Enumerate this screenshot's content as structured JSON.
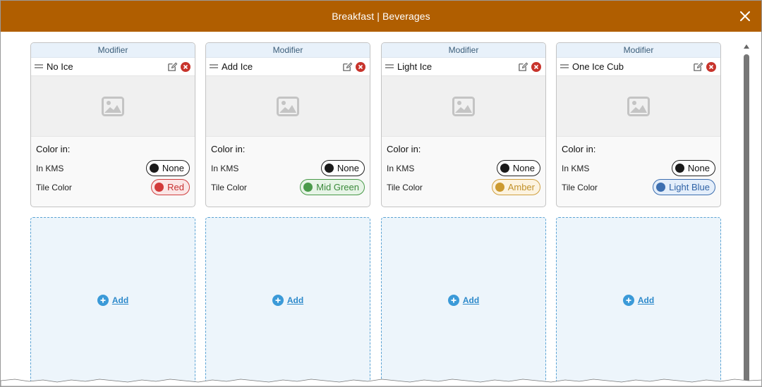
{
  "window": {
    "title": "Breakfast | Beverages"
  },
  "tiles": [
    {
      "header": "Modifier",
      "name": "No Ice",
      "color_in_label": "Color in:",
      "kms_label": "In KMS",
      "kms_value": "None",
      "tile_color_label": "Tile Color",
      "tile_color_value": "Red"
    },
    {
      "header": "Modifier",
      "name": "Add Ice",
      "color_in_label": "Color in:",
      "kms_label": "In KMS",
      "kms_value": "None",
      "tile_color_label": "Tile Color",
      "tile_color_value": "Mid Green"
    },
    {
      "header": "Modifier",
      "name": "Light Ice",
      "color_in_label": "Color in:",
      "kms_label": "In KMS",
      "kms_value": "None",
      "tile_color_label": "Tile Color",
      "tile_color_value": "Amber"
    },
    {
      "header": "Modifier",
      "name": "One Ice Cub",
      "color_in_label": "Color in:",
      "kms_label": "In KMS",
      "kms_value": "None",
      "tile_color_label": "Tile Color",
      "tile_color_value": "Light Blue"
    }
  ],
  "add_slots": [
    {
      "label": "Add"
    },
    {
      "label": "Add"
    },
    {
      "label": "Add"
    },
    {
      "label": "Add"
    }
  ],
  "colors": {
    "titlebar": "#b05e00",
    "red": "#d23a3a",
    "mid_green": "#4a9a4a",
    "amber": "#cc9a30",
    "light_blue": "#3d6fb0",
    "add_accent": "#3b9ad8"
  },
  "icons": {
    "close": "close-icon",
    "drag": "drag-handle-icon",
    "edit": "edit-icon",
    "delete": "delete-icon",
    "image": "image-placeholder-icon",
    "add": "plus-circle-icon",
    "scroll_up": "chevron-up-icon"
  }
}
